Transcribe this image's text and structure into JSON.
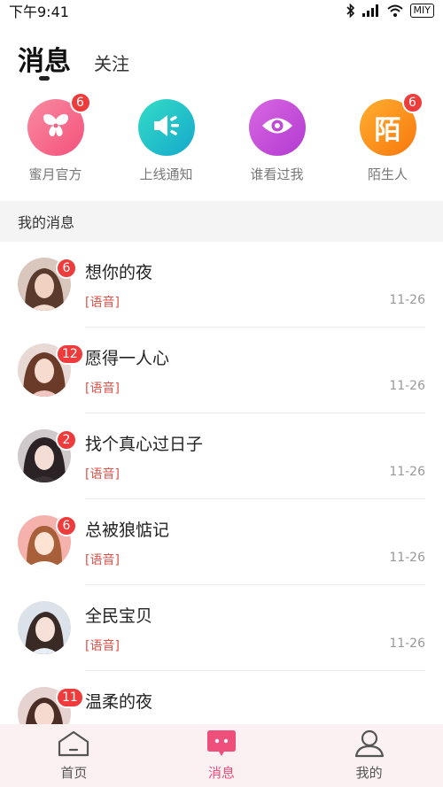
{
  "status_bar": {
    "time": "下午9:41",
    "carrier": "MIY"
  },
  "header": {
    "tabs": [
      {
        "label": "消息",
        "active": true
      },
      {
        "label": "关注",
        "active": false
      }
    ]
  },
  "shortcuts": [
    {
      "label": "蜜月官方",
      "icon": "butterfly-icon",
      "badge": "6",
      "color_from": "#f7758b",
      "color_to": "#f5517a"
    },
    {
      "label": "上线通知",
      "icon": "speaker-icon",
      "badge": "",
      "color_from": "#2fd3c6",
      "color_to": "#18b3ca"
    },
    {
      "label": "谁看过我",
      "icon": "eye-icon",
      "badge": "",
      "color_from": "#d05be0",
      "color_to": "#b43bd1"
    },
    {
      "label": "陌生人",
      "icon": "stranger-icon",
      "glyph": "陌",
      "badge": "6",
      "color_from": "#ffa326",
      "color_to": "#f97d12"
    }
  ],
  "section": {
    "title": "我的消息"
  },
  "messages": [
    {
      "name": "想你的夜",
      "tag": "[语音]",
      "date": "11-26",
      "badge": "6"
    },
    {
      "name": "愿得一人心",
      "tag": "[语音]",
      "date": "11-26",
      "badge": "12"
    },
    {
      "name": "找个真心过日子",
      "tag": "[语音]",
      "date": "11-26",
      "badge": "2"
    },
    {
      "name": "总被狼惦记",
      "tag": "[语音]",
      "date": "11-26",
      "badge": "6"
    },
    {
      "name": "全民宝贝",
      "tag": "[语音]",
      "date": "11-26",
      "badge": ""
    },
    {
      "name": "温柔的夜",
      "tag": "",
      "date": "",
      "badge": "11"
    }
  ],
  "bottom_nav": [
    {
      "label": "首页",
      "icon": "home-icon",
      "active": false
    },
    {
      "label": "消息",
      "icon": "chat-icon",
      "active": true
    },
    {
      "label": "我的",
      "icon": "profile-icon",
      "active": false
    }
  ],
  "colors": {
    "accent": "#ef4f7b",
    "badge": "#ee3b3b",
    "voice_tag": "#e0524a"
  }
}
